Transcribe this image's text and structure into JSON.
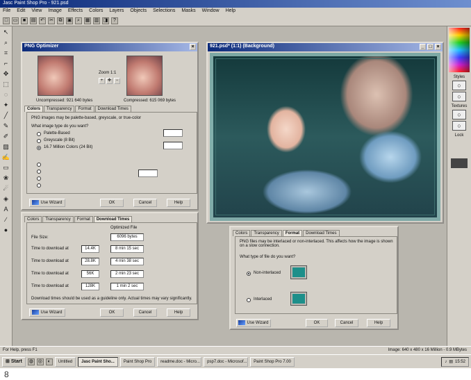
{
  "app": {
    "title": "Jasc Paint Shop Pro - 921.psd"
  },
  "menu": [
    "File",
    "Edit",
    "View",
    "Image",
    "Effects",
    "Colors",
    "Layers",
    "Objects",
    "Selections",
    "Masks",
    "Window",
    "Help"
  ],
  "png_dialog": {
    "title": "PNG Optimizer",
    "zoom_label": "Zoom 1:1",
    "uncompressed": "Uncompressed: 921 640 bytes",
    "compressed": "Compressed: 615 069 bytes",
    "tabs": [
      "Colors",
      "Transparency",
      "Format",
      "Download Times"
    ],
    "colors_panel": {
      "intro": "PNG images may be palette-based, greyscale, or true-color",
      "question": "What image type do you want?",
      "options": [
        "Palette-Based",
        "Greyscale (8 Bit)",
        "16.7 Million Colors (24 Bit)"
      ],
      "selected_index": 2
    },
    "buttons": {
      "wizard": "Use Wizard",
      "ok": "OK",
      "cancel": "Cancel",
      "help": "Help"
    }
  },
  "download_dialog": {
    "tabs": [
      "Colors",
      "Transparency",
      "Format",
      "Download Times"
    ],
    "column_header": "Optimized File",
    "file_size_label": "File Size:",
    "file_size_value": "6096 bytes",
    "rows": [
      {
        "label": "Time to download at",
        "speed": "14.4K",
        "time": "8 min 15 sec"
      },
      {
        "label": "Time to download at",
        "speed": "28.8K",
        "time": "4 min 38 sec"
      },
      {
        "label": "Time to download at",
        "speed": "56K",
        "time": "2 min 23 sec"
      },
      {
        "label": "Time to download at",
        "speed": "128K",
        "time": "1 min 2 sec"
      }
    ],
    "note": "Download times should be used as a guideline only. Actual times may vary significantly.",
    "buttons": {
      "wizard": "Use Wizard",
      "ok": "OK",
      "cancel": "Cancel",
      "help": "Help"
    }
  },
  "format_dialog": {
    "tabs": [
      "Colors",
      "Transparency",
      "Format",
      "Download Times"
    ],
    "description": "PNG files may be interlaced or non-interlaced. This affects how the image is shown on a slow connection.",
    "question": "What type of file do you want?",
    "options": [
      "Non-interlaced",
      "Interlaced"
    ],
    "selected_index": 0,
    "buttons": {
      "wizard": "Use Wizard",
      "ok": "OK",
      "cancel": "Cancel",
      "help": "Help"
    },
    "swatch_color": "#1d8f8a"
  },
  "image_window": {
    "title": "921.psd* (1:1) (Background)"
  },
  "palette": {
    "styles_label": "Styles",
    "textures_label": "Textures",
    "lock_label": "Lock"
  },
  "status": {
    "left": "For Help, press F1",
    "right": "Image: 640 x 480 x 16 Million - 0.9 MBytes"
  },
  "taskbar": {
    "start": "Start",
    "tasks": [
      "Untitled",
      "Jasc Paint Sho...",
      "Paint Shop Pro",
      "readme.doc - Micro...",
      "psp7.doc - Microsof...",
      "Paint Shop Pro 7.00"
    ],
    "active_index": 1,
    "clock": "15:52"
  },
  "caption": {
    "figure_number": "8"
  }
}
